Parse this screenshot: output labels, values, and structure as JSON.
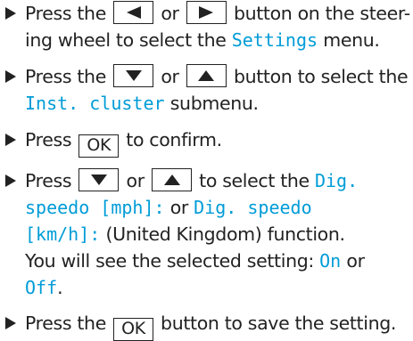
{
  "steps": [
    {
      "p1": "Press the",
      "key1_icon": "arrow-left-icon",
      "or": "or",
      "key2_icon": "arrow-right-icon",
      "p2": "button on the steer-",
      "p3": "ing wheel to select the",
      "display": "Settings",
      "p4": "menu."
    },
    {
      "p1": "Press the",
      "key1_icon": "arrow-down-icon",
      "or": "or",
      "key2_icon": "arrow-up-icon",
      "p2": "button to select the",
      "display": "Inst. cluster",
      "p3": "submenu."
    },
    {
      "p1": "Press",
      "key": "OK",
      "p2": "to confirm."
    },
    {
      "p1": "Press",
      "key1_icon": "arrow-down-icon",
      "or": "or",
      "key2_icon": "arrow-up-icon",
      "p2": "to select the",
      "display1a": "Dig.",
      "display1b": "speedo [mph]:",
      "or2": "or",
      "display2a": "Dig. speedo",
      "display2b": "[km/h]:",
      "p3": "(United Kingdom) function.",
      "p4": "You will see the selected setting:",
      "value_on": "On",
      "or3": "or",
      "value_off": "Off",
      "period": "."
    },
    {
      "p1": "Press the",
      "key": "OK",
      "p2": "button to save the setting."
    }
  ],
  "colors": {
    "text": "#222222",
    "display_text": "#009cd7"
  }
}
